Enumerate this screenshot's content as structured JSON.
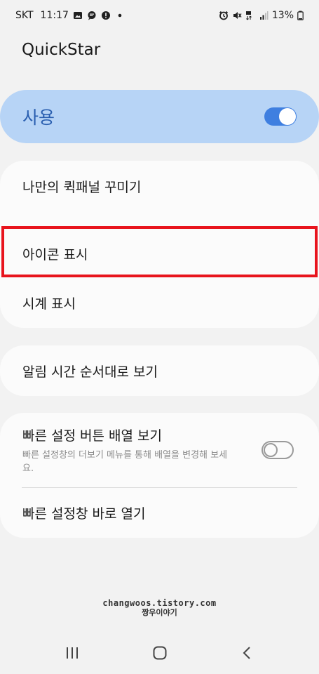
{
  "status_bar": {
    "carrier": "SKT",
    "time": "11:17",
    "battery": "13%"
  },
  "app": {
    "title": "QuickStar"
  },
  "master": {
    "label": "사용",
    "enabled": true
  },
  "items": {
    "customize": "나만의 퀵패널 꾸미기",
    "show_icons": "아이콘 표시",
    "show_clock": "시계 표시",
    "notification_order": "알림 시간 순서대로 보기",
    "quick_settings_layout": {
      "title": "빠른 설정 버튼 배열 보기",
      "subtitle": "빠른 설정창의 더보기 메뉴를 통해 배열을 변경해 보세요.",
      "enabled": false
    },
    "open_quick_settings": "빠른 설정창 바로 열기"
  },
  "watermark": {
    "line1": "changwoos.tistory.com",
    "line2": "짱우이야기"
  },
  "colors": {
    "accent": "#3f7fe0",
    "master_bg": "#b7d4f6",
    "highlight": "#e8141d"
  },
  "icons": {
    "status_left": [
      "gallery-icon",
      "chat-icon",
      "alert-icon",
      "dot-icon"
    ],
    "status_right": [
      "alarm-icon",
      "mute-icon",
      "lte-icon",
      "signal-icon",
      "battery-icon"
    ],
    "nav": [
      "recent-apps-icon",
      "home-icon",
      "back-icon"
    ]
  }
}
